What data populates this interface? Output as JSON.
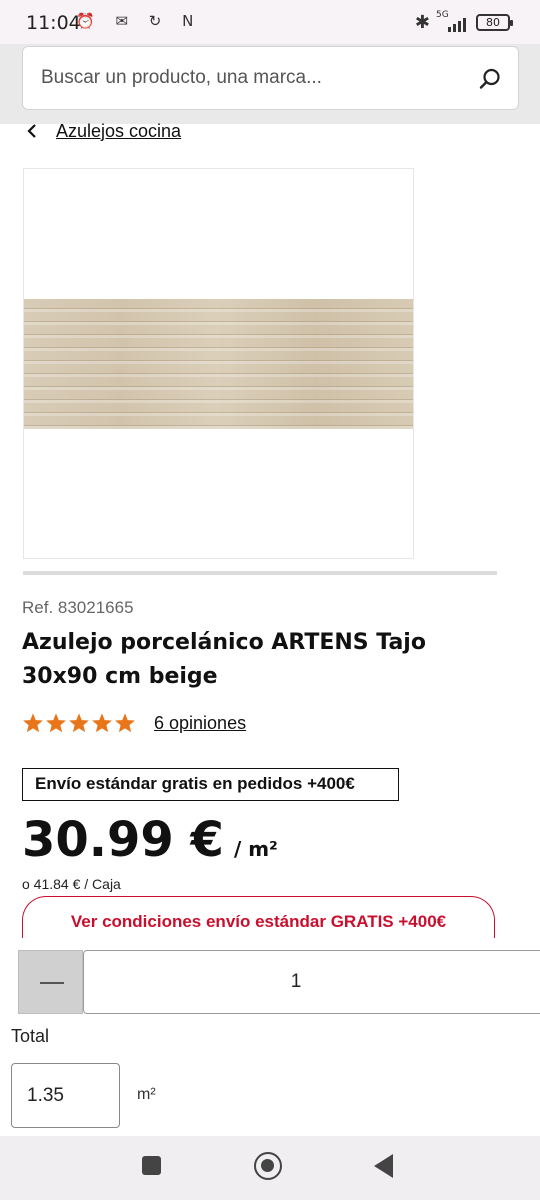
{
  "status_bar": {
    "time": "11:04",
    "left_icons": "⏰ ✉ ↻ N",
    "network": "5G",
    "battery": "80"
  },
  "search": {
    "placeholder": "Buscar un producto, una marca..."
  },
  "breadcrumb": {
    "label": "Azulejos cocina"
  },
  "product": {
    "ref": "Ref. 83021665",
    "title": "Azulejo porcelánico ARTENS Tajo 30x90 cm beige",
    "rating": {
      "stars": 5,
      "reviews_label": "6 opiniones"
    },
    "shipping_badge": "Envío estándar gratis en pedidos +400€",
    "price": "30.99 €",
    "price_unit": "/ m²",
    "price_alt": "o 41.84 € / Caja",
    "shipping_cta": "Ver condiciones envío estándar GRATIS +400€"
  },
  "purchase": {
    "quantity": "1",
    "total_label": "Total",
    "total_value": "1.35",
    "total_unit": "m²"
  },
  "colors": {
    "star": "#e8751a",
    "accent_red": "#c8102e"
  }
}
